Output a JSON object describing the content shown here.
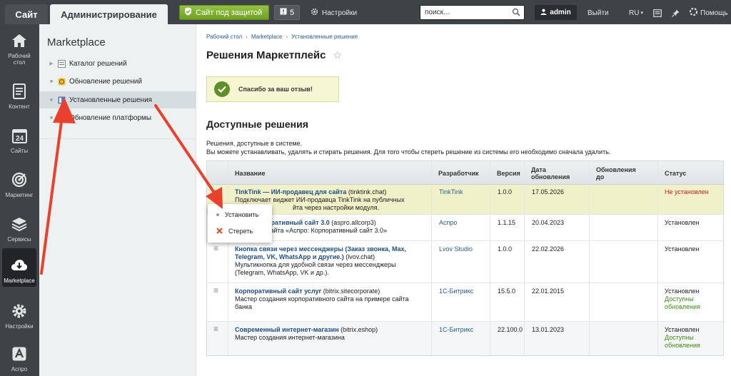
{
  "topbar": {
    "tab_site": "Сайт",
    "tab_admin": "Администрирование",
    "protect_label": "Сайт под защитой",
    "notif_count": "5",
    "settings_label": "Настройки",
    "search_placeholder": "поиск...",
    "user_name": "admin",
    "logout_label": "Выйти",
    "lang": "RU",
    "help_label": "Помощь"
  },
  "leftmenu": {
    "items": [
      {
        "label": "Рабочий стол",
        "icon": "home-icon"
      },
      {
        "label": "Контент",
        "icon": "document-icon"
      },
      {
        "label": "Сайты",
        "icon": "calendar-icon"
      },
      {
        "label": "Маркетинг",
        "icon": "target-icon"
      },
      {
        "label": "Сервисы",
        "icon": "layers-icon"
      },
      {
        "label": "Marketplace",
        "icon": "cloud-download-icon"
      },
      {
        "label": "Настройки",
        "icon": "gear-icon"
      },
      {
        "label": "Аспро",
        "icon": "aspro-logo-icon"
      }
    ]
  },
  "sidebar": {
    "title": "Marketplace",
    "items": [
      {
        "label": "Каталог решений"
      },
      {
        "label": "Обновление решений"
      },
      {
        "label": "Установленные решения"
      },
      {
        "label": "Обновление платформы"
      }
    ]
  },
  "main": {
    "breadcrumbs": [
      "Рабочий стол",
      "Marketplace",
      "Установленные решения"
    ],
    "title": "Решения Маркетплейс",
    "notice": "Спасибо за ваш отзыв!",
    "section_title": "Доступные решения",
    "desc_line1": "Решения, доступные в системе.",
    "desc_line2": "Вы можете устанавливать, удалять и стирать решения. Для того чтобы стереть решение из системы его необходимо сначала удалить.",
    "columns": {
      "name": "Название",
      "dev": "Разработчик",
      "version": "Версия",
      "date1": "Дата",
      "date2": "обновления",
      "upd1": "Обновления",
      "upd2": "до",
      "status": "Статус"
    },
    "rows": [
      {
        "name": "TinkTink — ИИ-продавец для сайта",
        "code": "(tinktink.chat)",
        "desc1": "Подключает виджет ИИ-продавца TinkTink на публичных",
        "desc2": "йта через настройки модуля.",
        "dev": "TinkTink",
        "version": "1.0.0",
        "date": "17.05.2026",
        "status": "Не установлен",
        "status2": ""
      },
      {
        "name": "оративный сайт 3.0",
        "code": "(aspro.allcorp3)",
        "desc1": "сайта «Аспро: Корпоративный сайт 3.0»",
        "desc2": "",
        "dev": "Аспро",
        "version": "1.1.15",
        "date": "20.04.2023",
        "status": "Установлен",
        "status2": ""
      },
      {
        "name": "Кнопка связи через мессенджеры (Заказ звонка, Max,",
        "name2": "Telegram, VK, WhatsApp и другие.)",
        "code": "(lvov.chat)",
        "desc1": "Мультикнопка для удобной связи через мессенджеры",
        "desc2": "(Telegram, WhatsApp, VK и др.).",
        "dev": "Lvov Studio",
        "version": "1.0.0",
        "date": "22.02.2026",
        "status": "Установлен",
        "status2": ""
      },
      {
        "name": "Корпоративный сайт услуг",
        "code": "(bitrix.sitecorporate)",
        "desc1": "Мастер создания корпоративного сайта на примере сайта",
        "desc2": "банка",
        "dev": "1С-Битрикс",
        "version": "15.5.0",
        "date": "22.01.2015",
        "status": "Установлен",
        "status2a": "Доступны",
        "status2b": "обновления"
      },
      {
        "name": "Современный интернет-магазин",
        "code": "(bitrix.eshop)",
        "desc1": "Мастер создания интернет-магазина",
        "desc2": "",
        "dev": "1С-Битрикс",
        "version": "22.100.0",
        "date": "13.01.2023",
        "status": "Установлен",
        "status2a": "Доступны",
        "status2b": "обновления"
      }
    ]
  },
  "popup": {
    "install": "Установить",
    "erase": "Стереть"
  },
  "colors": {
    "topbar": "#3f4246",
    "accent_green": "#6fa126",
    "annotation_arrow": "#e8422e",
    "link": "#1f4e85",
    "status_not_installed": "#d0201a",
    "status_updates": "#3f8a15"
  }
}
